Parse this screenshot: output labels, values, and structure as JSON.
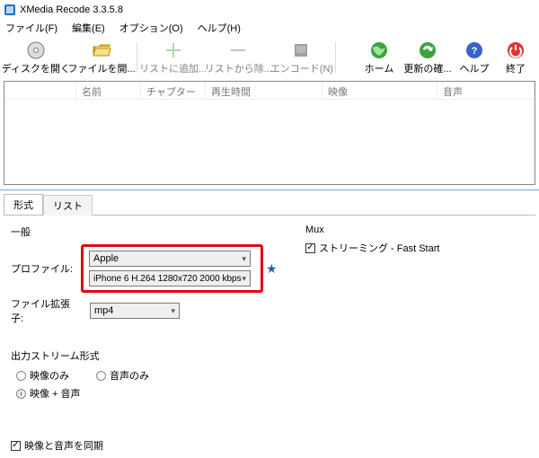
{
  "title": "XMedia Recode 3.3.5.8",
  "menu": {
    "file": "ファイル(F)",
    "edit": "編集(E)",
    "option": "オプション(O)",
    "help": "ヘルプ(H)"
  },
  "toolbar": {
    "open_disc": "ディスクを開く",
    "open_file": "ファイルを開...",
    "add_list": "リストに追加...",
    "remove_list": "リストから除...",
    "encode": "エンコード(N)",
    "home": "ホーム",
    "update": "更新の確...",
    "helpb": "ヘルプ",
    "exit": "終了"
  },
  "columns": {
    "name": "名前",
    "chapter": "チャプター",
    "playtime": "再生時間",
    "video": "映像",
    "audio": "音声"
  },
  "tabs": {
    "format": "形式",
    "list": "リスト"
  },
  "general": {
    "label": "一般",
    "profile_lbl": "プロファイル:",
    "profile_val": "Apple",
    "profile_detail": "iPhone 6 H.264 1280x720 2000 kbps",
    "ext_lbl": "ファイル拡張子:",
    "ext_val": "mp4"
  },
  "outstream": {
    "label": "出力ストリーム形式",
    "video_only": "映像のみ",
    "audio_only": "音声のみ",
    "video_audio": "映像 + 音声"
  },
  "mux": {
    "label": "Mux",
    "streaming": "ストリーミング - Fast Start"
  },
  "sync": "映像と音声を同期"
}
